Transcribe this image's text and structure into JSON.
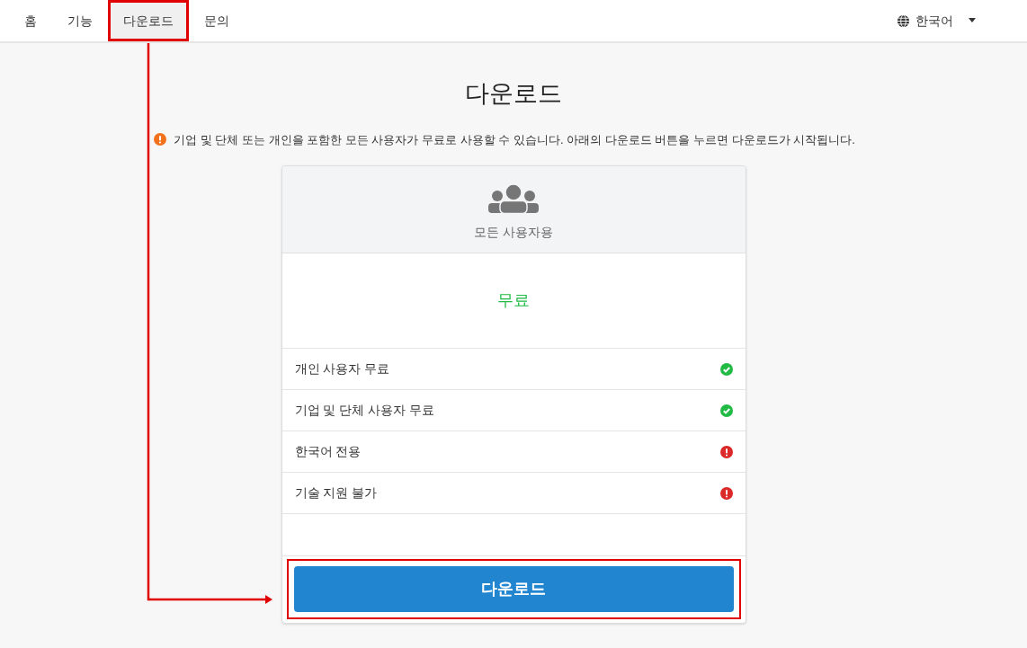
{
  "nav": {
    "items": [
      {
        "label": "홈",
        "selected": false,
        "highlighted": false
      },
      {
        "label": "기능",
        "selected": false,
        "highlighted": false
      },
      {
        "label": "다운로드",
        "selected": true,
        "highlighted": true
      },
      {
        "label": "문의",
        "selected": false,
        "highlighted": false
      }
    ],
    "language": "한국어"
  },
  "page_title": "다운로드",
  "notice": "기업 및 단체 또는 개인을 포함한 모든 사용자가 무료로 사용할 수 있습니다. 아래의 다운로드 버튼을 누르면 다운로드가 시작됩니다.",
  "plan": {
    "name": "모든 사용자용",
    "price": "무료",
    "features": [
      {
        "label": "개인 사용자 무료",
        "kind": "yes"
      },
      {
        "label": "기업 및 단체 사용자 무료",
        "kind": "yes"
      },
      {
        "label": "한국어 전용",
        "kind": "no"
      },
      {
        "label": "기술 지원 불가",
        "kind": "no"
      }
    ],
    "button": {
      "label": "다운로드",
      "highlighted": true
    }
  },
  "annotation": {
    "kind": "arrow"
  }
}
